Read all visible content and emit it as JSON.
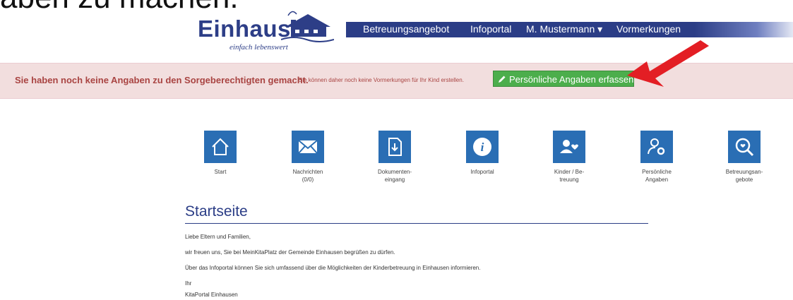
{
  "cropped_heading": "aben zu machen.",
  "logo": {
    "word": "Einhausen",
    "tagline": "einfach lebenswert"
  },
  "nav": {
    "items": [
      {
        "label": "Betreuungsangebot"
      },
      {
        "label": "Infoportal"
      },
      {
        "label": "M. Mustermann ▾"
      },
      {
        "label": "Vormerkungen"
      }
    ]
  },
  "alert": {
    "strong": "Sie haben noch keine Angaben zu den Sorgeberechtigten gemacht.",
    "small": "Sie können daher noch keine Vormerkungen für Ihr Kind erstellen.",
    "button": "Persönliche Angaben erfassen"
  },
  "tiles": [
    {
      "label": "Start",
      "icon": "home-icon"
    },
    {
      "label": "Nachrichten\n(0/0)",
      "icon": "envelope-icon"
    },
    {
      "label": "Dokumenten-\neingang",
      "icon": "document-download-icon"
    },
    {
      "label": "Infoportal",
      "icon": "info-icon"
    },
    {
      "label": "Kinder / Be-\ntreuung",
      "icon": "children-heart-icon"
    },
    {
      "label": "Persönliche\nAngaben",
      "icon": "user-settings-icon"
    },
    {
      "label": "Betreuungsan-\ngebote",
      "icon": "search-heart-icon"
    }
  ],
  "main": {
    "title": "Startseite",
    "paragraphs": [
      "Liebe Eltern und Familien,",
      "wir freuen uns, Sie bei MeinKitaPlatz der Gemeinde Einhausen begrüßen zu dürfen.",
      "Über das Infoportal können Sie sich umfassend über die Möglichkeiten der Kinderbetreuung in Einhausen informieren.",
      "Ihr",
      "KitaPortal Einhausen"
    ]
  },
  "colors": {
    "brand": "#2b3d86",
    "tile": "#2a6eb4",
    "alert_bg": "#f2dede",
    "alert_text": "#a94442",
    "success": "#4cae4c",
    "arrow": "#e31e24"
  }
}
